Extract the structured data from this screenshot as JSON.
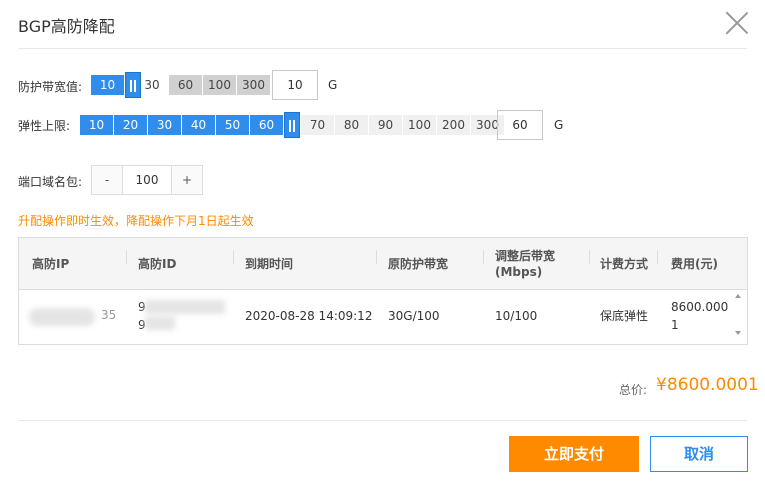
{
  "dialog": {
    "title": "BGP高防降配"
  },
  "bandwidth": {
    "label": "防护带宽值:",
    "selected": "10",
    "options": [
      "30",
      "60",
      "100",
      "300"
    ],
    "input_value": "10",
    "unit": "G"
  },
  "elastic": {
    "label": "弹性上限:",
    "active_options": [
      "10",
      "20",
      "30",
      "40",
      "50",
      "60"
    ],
    "rest_options": [
      "70",
      "80",
      "90",
      "100",
      "200",
      "300"
    ],
    "input_value": "60",
    "unit": "G"
  },
  "ports": {
    "label": "端口域名包:",
    "minus": "-",
    "value": "100",
    "plus": "+"
  },
  "notice": "升配操作即时生效，降配操作下月1日起生效",
  "table": {
    "headers": [
      "高防IP",
      "高防ID",
      "到期时间",
      "原防护带宽",
      "调整后带宽(Mbps)",
      "计费方式",
      "费用(元)"
    ],
    "row": {
      "ip_suffix": "35",
      "id_line1": "9",
      "id_line2": "9",
      "expire": "2020-08-28 14:09:12",
      "orig_bw": "30G/100",
      "new_bw": "10/100",
      "billing": "保底弹性",
      "fee_line1": "8600.000",
      "fee_line2": "1"
    }
  },
  "total": {
    "label": "总价:",
    "value": "¥8600.0001"
  },
  "buttons": {
    "pay": "立即支付",
    "cancel": "取消"
  }
}
